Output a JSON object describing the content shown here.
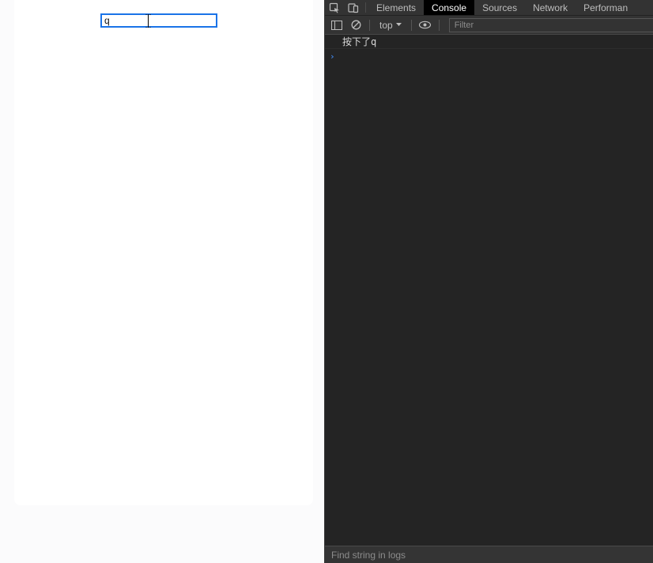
{
  "page": {
    "input_value": "q"
  },
  "devtools": {
    "tabs": {
      "elements": "Elements",
      "console": "Console",
      "sources": "Sources",
      "network": "Network",
      "performance": "Performan"
    },
    "toolbar": {
      "context": "top",
      "filter_placeholder": "Filter"
    },
    "logs": [
      "按下了q"
    ],
    "bottom": {
      "find_placeholder": "Find string in logs"
    }
  }
}
